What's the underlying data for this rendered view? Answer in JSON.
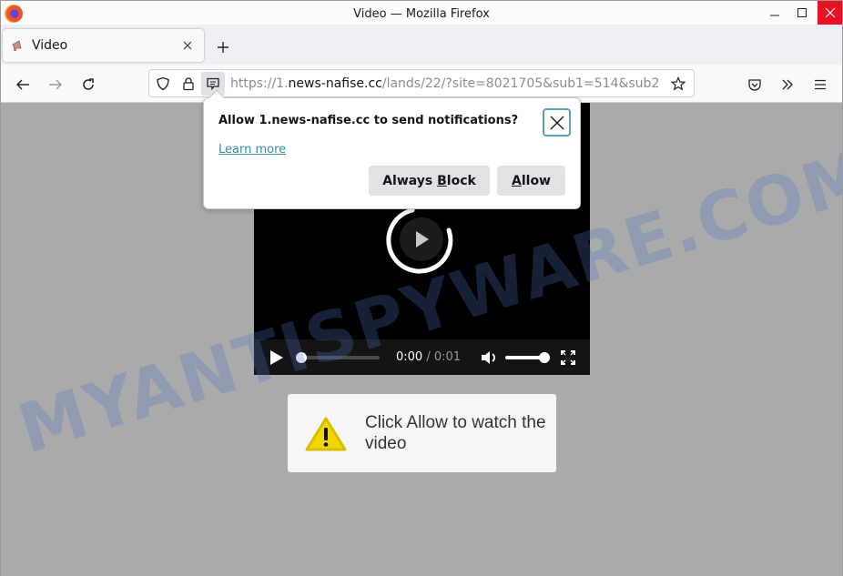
{
  "window": {
    "title": "Video — Mozilla Firefox",
    "controls": {
      "minimize": "minimize-icon",
      "maximize": "maximize-icon",
      "close": "close-icon"
    },
    "close_color": "#e81123"
  },
  "tabs": [
    {
      "title": "Video",
      "active": true,
      "favicon": "megaphone-icon"
    }
  ],
  "new_tab_icon": "plus-icon",
  "navbar": {
    "back": "arrow-left-icon",
    "forward": "arrow-right-icon",
    "reload": "reload-icon",
    "url_prefix": "https://1.",
    "url_host": "news-nafise.cc",
    "url_rest": "/lands/22/?site=8021705&sub1=514&sub2",
    "right_icons": [
      "pocket-icon",
      "overflow-chevrons-icon",
      "hamburger-menu-icon"
    ]
  },
  "popup": {
    "message": "Allow 1.news-nafise.cc to send notifications?",
    "learn_more": "Learn more",
    "block_pre": "Always ",
    "block_key": "B",
    "block_post": "lock",
    "allow_key": "A",
    "allow_post": "llow",
    "accent": "#3b8aa5"
  },
  "video": {
    "current_time": "0:00",
    "separator": " / ",
    "duration": "0:01",
    "progress_fraction": 0.0,
    "volume_fraction": 1.0
  },
  "notice": {
    "text": "Click Allow to watch the video",
    "icon": "warning-triangle-icon",
    "icon_color": "#f2d600"
  },
  "watermark": "MYANTISPYWARE.COM"
}
